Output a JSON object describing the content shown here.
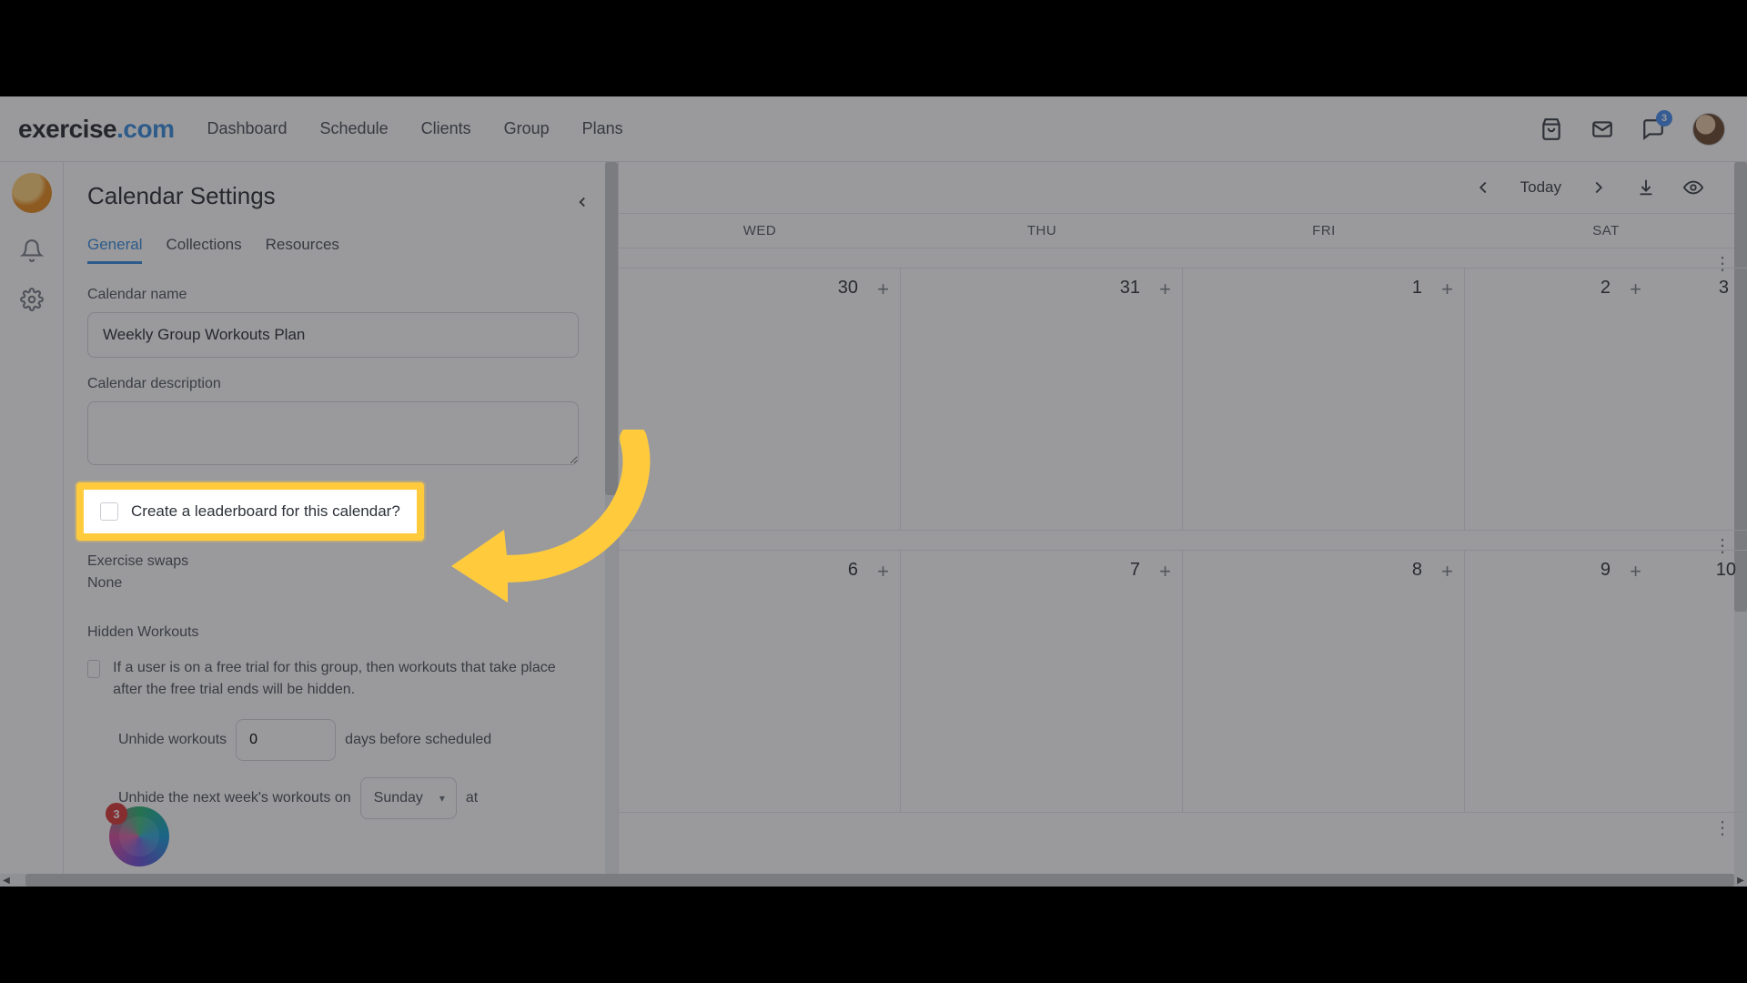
{
  "brand": {
    "name": "exercise",
    "suffix": ".com"
  },
  "nav": {
    "items": [
      "Dashboard",
      "Schedule",
      "Clients",
      "Group",
      "Plans"
    ],
    "chat_badge": "3"
  },
  "panel": {
    "title": "Calendar Settings",
    "tabs": [
      "General",
      "Collections",
      "Resources"
    ],
    "active_tab": 0,
    "calendar_name_label": "Calendar name",
    "calendar_name_value": "Weekly Group Workouts Plan",
    "description_label": "Calendar description",
    "description_value": "",
    "leaderboard_label": "Create a leaderboard for this calendar?",
    "exercise_swaps_label": "Exercise swaps",
    "exercise_swaps_value": "None",
    "hidden_workouts_label": "Hidden Workouts",
    "free_trial_text": "If a user is on a free trial for this group, then workouts that take place after the free trial ends will be hidden.",
    "unhide_before_prefix": "Unhide workouts",
    "unhide_before_days": "0",
    "unhide_before_suffix": "days before scheduled",
    "unhide_next_prefix": "Unhide the next week's workouts on",
    "unhide_next_day": "Sunday",
    "unhide_next_suffix": "at"
  },
  "calendar": {
    "today_label": "Today",
    "days": [
      "WED",
      "THU",
      "FRI",
      "SAT"
    ],
    "rows": [
      [
        {
          "num": "30"
        },
        {
          "num": "31"
        },
        {
          "num": "1"
        },
        {
          "num": "2",
          "extra": "3"
        }
      ],
      [
        {
          "num": "6"
        },
        {
          "num": "7"
        },
        {
          "num": "8"
        },
        {
          "num": "9",
          "extra": "10"
        }
      ]
    ]
  },
  "float_badge": {
    "count": "3"
  }
}
